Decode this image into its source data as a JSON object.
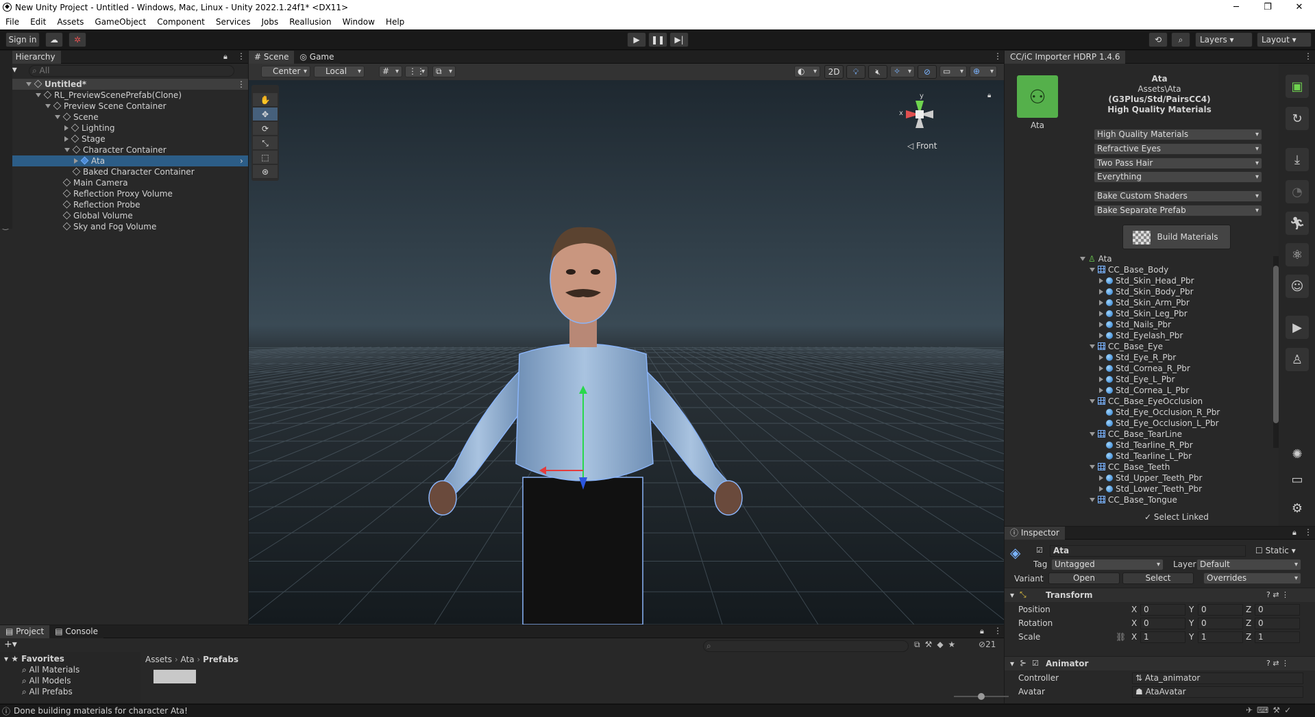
{
  "window": {
    "title": "New Unity Project - Untitled - Windows, Mac, Linux - Unity 2022.1.24f1* <DX11>",
    "minimize": "─",
    "maximize": "❐",
    "close": "✕"
  },
  "menu": [
    "File",
    "Edit",
    "Assets",
    "GameObject",
    "Component",
    "Services",
    "Jobs",
    "Reallusion",
    "Window",
    "Help"
  ],
  "toolbar": {
    "signin": "Sign in",
    "layers": "Layers",
    "layout": "Layout"
  },
  "hierarchy": {
    "tab": "Hierarchy",
    "search_placeholder": "All",
    "items": [
      {
        "label": "Untitled*",
        "depth": 0
      },
      {
        "label": "RL_PreviewScenePrefab(Clone)",
        "depth": 1
      },
      {
        "label": "Preview Scene Container",
        "depth": 2
      },
      {
        "label": "Scene",
        "depth": 3
      },
      {
        "label": "Lighting",
        "depth": 4
      },
      {
        "label": "Stage",
        "depth": 4
      },
      {
        "label": "Character Container",
        "depth": 4
      },
      {
        "label": "Ata",
        "depth": 5
      },
      {
        "label": "Baked Character Container",
        "depth": 4
      },
      {
        "label": "Main Camera",
        "depth": 3
      },
      {
        "label": "Reflection Proxy Volume",
        "depth": 3
      },
      {
        "label": "Reflection Probe",
        "depth": 3
      },
      {
        "label": "Global Volume",
        "depth": 3
      },
      {
        "label": "Sky and Fog Volume",
        "depth": 3
      }
    ]
  },
  "scene": {
    "tab_scene": "Scene",
    "tab_game": "Game",
    "pivot": "Center",
    "space": "Local",
    "mode2d": "2D",
    "gizmo_label": "Front",
    "gizmo_x": "x",
    "gizmo_y": "y"
  },
  "importer": {
    "tab": "CC/iC Importer HDRP 1.4.6",
    "char_name": "Ata",
    "path": "Assets\\Ata",
    "type": "(G3Plus/Std/PairsCC4)",
    "quality": "High Quality Materials",
    "icon_label": "Ata",
    "dropdowns": [
      "High Quality Materials",
      "Refractive Eyes",
      "Two Pass Hair",
      "Everything"
    ],
    "dropdowns2": [
      "Bake Custom Shaders",
      "Bake Separate Prefab"
    ],
    "build": "Build Materials",
    "tree": [
      {
        "label": "Ata",
        "kind": "root",
        "depth": 0
      },
      {
        "label": "CC_Base_Body",
        "kind": "mesh",
        "depth": 1
      },
      {
        "label": "Std_Skin_Head_Pbr",
        "kind": "mat",
        "depth": 2
      },
      {
        "label": "Std_Skin_Body_Pbr",
        "kind": "mat",
        "depth": 2
      },
      {
        "label": "Std_Skin_Arm_Pbr",
        "kind": "mat",
        "depth": 2
      },
      {
        "label": "Std_Skin_Leg_Pbr",
        "kind": "mat",
        "depth": 2
      },
      {
        "label": "Std_Nails_Pbr",
        "kind": "mat",
        "depth": 2
      },
      {
        "label": "Std_Eyelash_Pbr",
        "kind": "mat",
        "depth": 2
      },
      {
        "label": "CC_Base_Eye",
        "kind": "mesh",
        "depth": 1
      },
      {
        "label": "Std_Eye_R_Pbr",
        "kind": "mat",
        "depth": 2
      },
      {
        "label": "Std_Cornea_R_Pbr",
        "kind": "mat",
        "depth": 2
      },
      {
        "label": "Std_Eye_L_Pbr",
        "kind": "mat",
        "depth": 2
      },
      {
        "label": "Std_Cornea_L_Pbr",
        "kind": "mat",
        "depth": 2
      },
      {
        "label": "CC_Base_EyeOcclusion",
        "kind": "mesh",
        "depth": 1
      },
      {
        "label": "Std_Eye_Occlusion_R_Pbr",
        "kind": "mat",
        "depth": 2
      },
      {
        "label": "Std_Eye_Occlusion_L_Pbr",
        "kind": "mat",
        "depth": 2
      },
      {
        "label": "CC_Base_TearLine",
        "kind": "mesh",
        "depth": 1
      },
      {
        "label": "Std_Tearline_R_Pbr",
        "kind": "mat",
        "depth": 2
      },
      {
        "label": "Std_Tearline_L_Pbr",
        "kind": "mat",
        "depth": 2
      },
      {
        "label": "CC_Base_Teeth",
        "kind": "mesh",
        "depth": 1
      },
      {
        "label": "Std_Upper_Teeth_Pbr",
        "kind": "mat",
        "depth": 2
      },
      {
        "label": "Std_Lower_Teeth_Pbr",
        "kind": "mat",
        "depth": 2
      },
      {
        "label": "CC_Base_Tongue",
        "kind": "mesh",
        "depth": 1
      }
    ],
    "select_linked": "Select Linked"
  },
  "inspector": {
    "tab": "Inspector",
    "name": "Ata",
    "static": "Static",
    "tag_label": "Tag",
    "tag": "Untagged",
    "layer_label": "Layer",
    "layer": "Default",
    "variant": "Variant",
    "open": "Open",
    "select": "Select",
    "overrides": "Overrides",
    "transform": "Transform",
    "position": "Position",
    "rotation": "Rotation",
    "scale": "Scale",
    "pos": [
      "0",
      "0",
      "0"
    ],
    "rot": [
      "0",
      "0",
      "0"
    ],
    "scl": [
      "1",
      "1",
      "1"
    ],
    "animator": "Animator",
    "controller_label": "Controller",
    "controller": "Ata_animator",
    "avatar_label": "Avatar",
    "avatar": "AtaAvatar"
  },
  "project": {
    "tab_project": "Project",
    "tab_console": "Console",
    "favorites": "Favorites",
    "fav_items": [
      "All Materials",
      "All Models",
      "All Prefabs"
    ],
    "breadcrumb": [
      "Assets",
      "Ata",
      "Prefabs"
    ],
    "hidden_count": "21"
  },
  "status": {
    "text": "Done building materials for character Ata!"
  }
}
